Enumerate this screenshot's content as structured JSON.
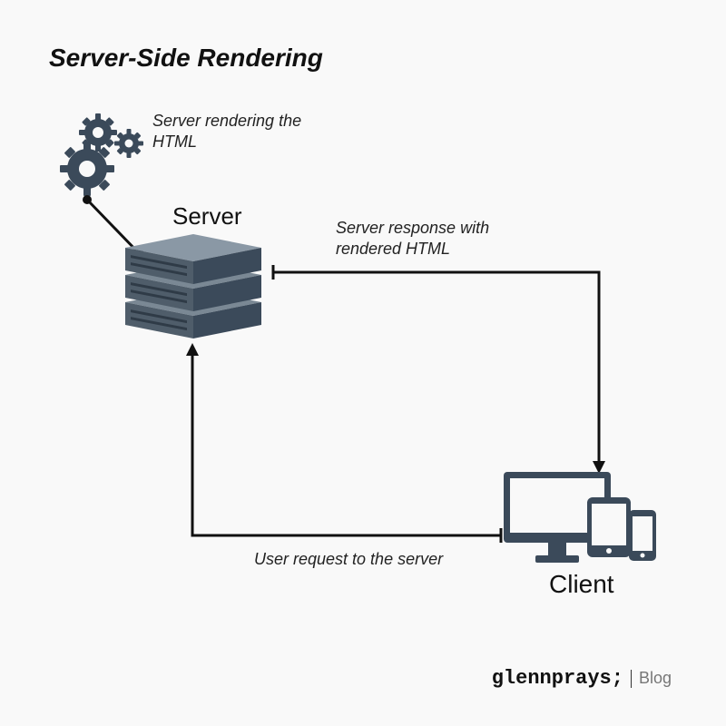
{
  "title": "Server-Side Rendering",
  "gears": {
    "caption": "Server rendering the HTML"
  },
  "server": {
    "label": "Server"
  },
  "flows": {
    "response": "Server response with rendered HTML",
    "request": "User request to the server"
  },
  "client": {
    "label": "Client"
  },
  "footer": {
    "brand": "glennprays;",
    "section": "Blog"
  },
  "colors": {
    "ink": "#111",
    "icon": "#3b4a5a",
    "silver": "#8899a6"
  }
}
